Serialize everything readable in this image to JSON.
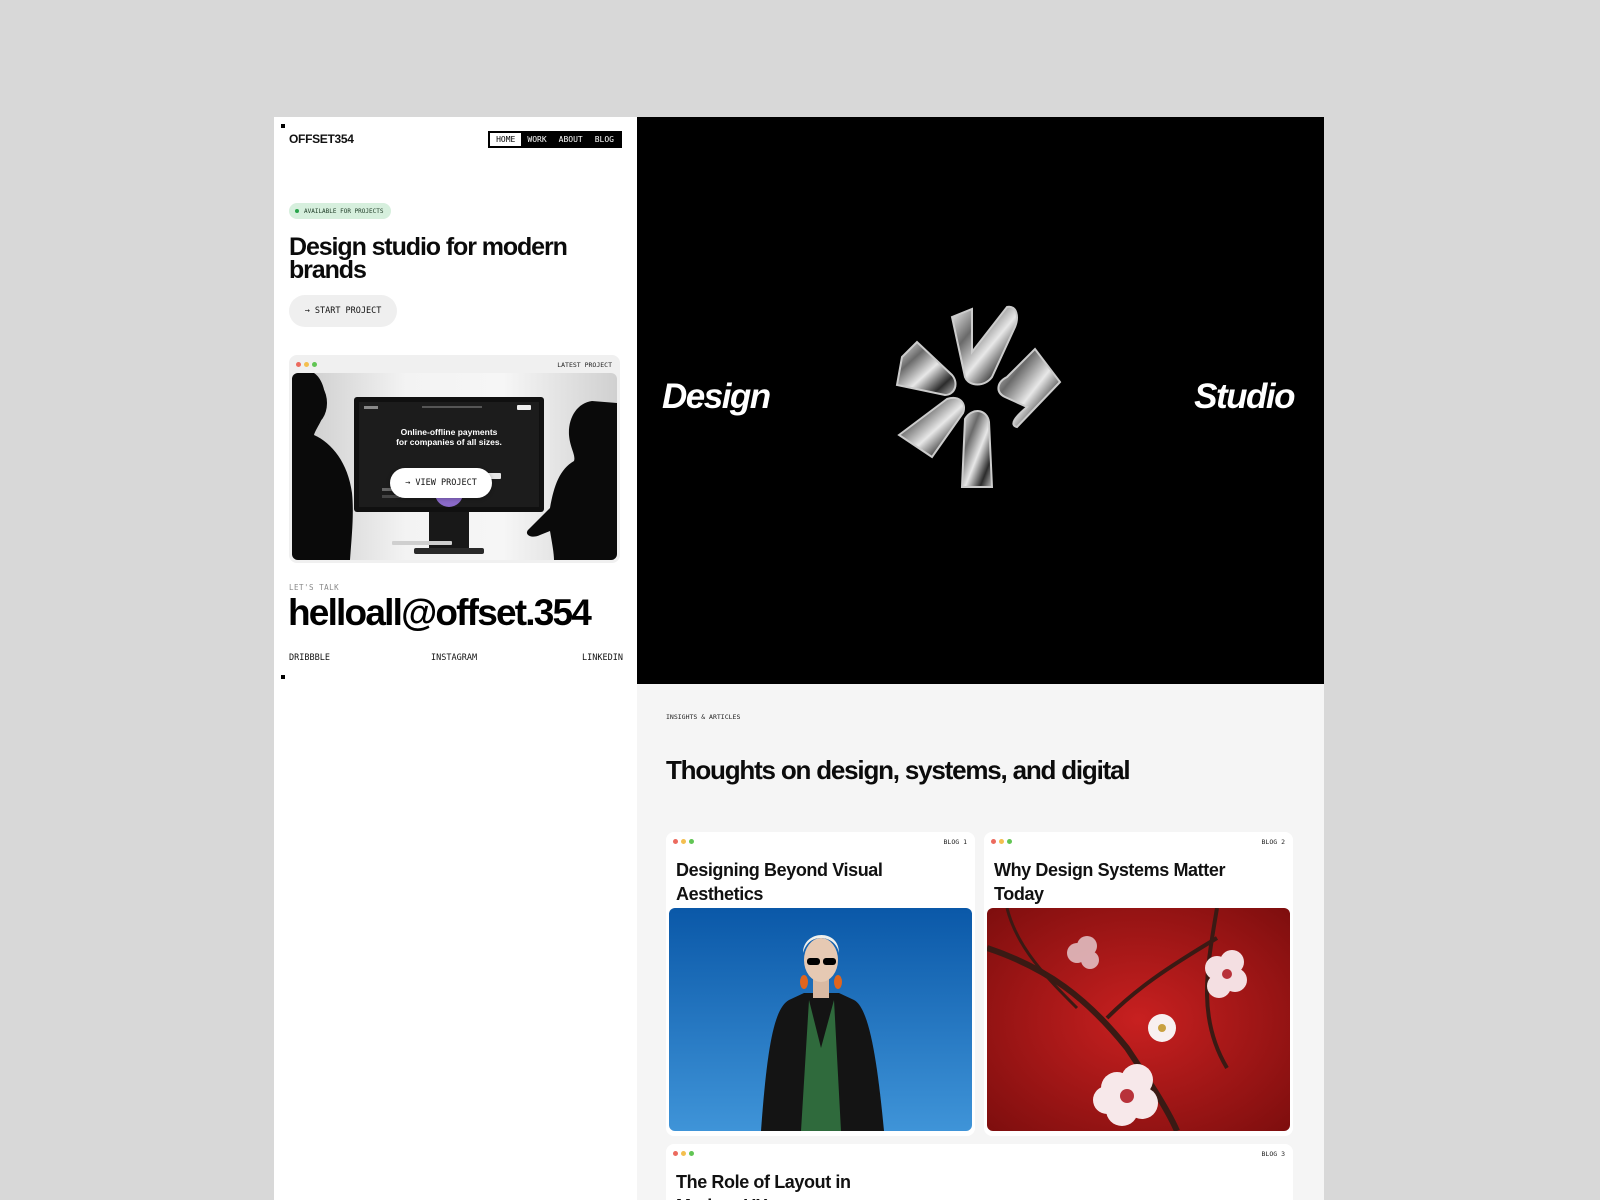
{
  "brand": {
    "logo": "OFFSET354"
  },
  "nav": {
    "items": [
      "HOME",
      "WORK",
      "ABOUT",
      "BLOG"
    ],
    "active": "HOME"
  },
  "hero_left": {
    "badge": "AVAILABLE FOR PROJECTS",
    "title": "Design studio for modern brands",
    "cta": "→ START PROJECT"
  },
  "latest_project": {
    "tag": "LATEST PROJECT",
    "screen_headline": "Online-offline payments for companies of all sizes.",
    "view_button": "→ VIEW PROJECT"
  },
  "contact": {
    "label": "LET'S TALK",
    "email": "helloall@offset.354",
    "socials": [
      "DRIBBBLE",
      "INSTAGRAM",
      "LINKEDIN"
    ]
  },
  "hero_right": {
    "word_left": "Design",
    "word_right": "Studio"
  },
  "blog": {
    "section_label": "INSIGHTS & ARTICLES",
    "heading": "Thoughts on design, systems, and digital",
    "posts": [
      {
        "tag": "BLOG 1",
        "title": "Designing Beyond Visual Aesthetics"
      },
      {
        "tag": "BLOG 2",
        "title": "Why Design Systems Matter Today"
      },
      {
        "tag": "BLOG 3",
        "title": "The Role of Layout in Modern UX"
      }
    ]
  },
  "colors": {
    "accent_green": "#29a54c",
    "badge_bg": "#d6efdd",
    "hero_bg": "#000000",
    "blog_red": "#b21818",
    "sky_blue": "#1f6fb8"
  }
}
